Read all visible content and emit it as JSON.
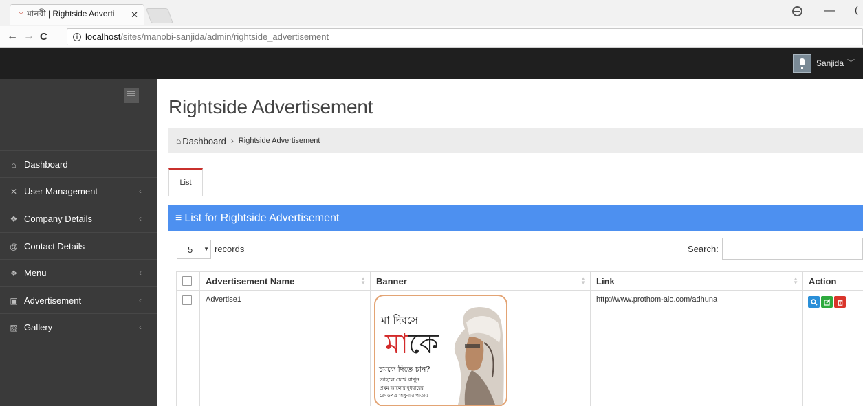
{
  "browser": {
    "tab_title": "মানবী | Rightside Adverti",
    "url_host": "localhost",
    "url_path": "/sites/manobi-sanjida/admin/rightside_advertisement"
  },
  "topbar": {
    "username": "Sanjida"
  },
  "sidebar": {
    "items": [
      {
        "label": "Dashboard",
        "icon": "home-icon"
      },
      {
        "label": "User Management",
        "icon": "arrows-icon"
      },
      {
        "label": "Company Details",
        "icon": "dropbox-icon"
      },
      {
        "label": "Contact Details",
        "icon": "at-icon"
      },
      {
        "label": "Menu",
        "icon": "dropbox-icon"
      },
      {
        "label": "Advertisement",
        "icon": "play-square-icon"
      },
      {
        "label": "Gallery",
        "icon": "image-icon"
      }
    ]
  },
  "page": {
    "title": "Rightside Advertisement",
    "breadcrumb": {
      "home": "Dashboard",
      "current": "Rightside Advertisement"
    },
    "tab": "List",
    "panel_title": "List for Rightside Advertisement"
  },
  "controls": {
    "page_length": "5",
    "records_label": "records",
    "search_label": "Search:"
  },
  "table": {
    "headers": [
      "Advertisement Name",
      "Banner",
      "Link",
      "Action"
    ],
    "rows": [
      {
        "name": "Advertise1",
        "link": "http://www.prothom-alo.com/adhuna",
        "banner": {
          "line1": "মা দিবসে",
          "big_red": "মা",
          "big_black": "কে",
          "line3": "চমকে দিতে চান?",
          "line4": "তাহলে চোখ রাখুন",
          "line5": "প্রথম আলোর বুধবারের",
          "line6": "ক্রোড়পত্র 'অধুনা'র পাতায়"
        }
      }
    ]
  },
  "colors": {
    "panel_header": "#4d90f0",
    "active_tab_border": "#c9302c",
    "sidebar_bg": "#3a3a3a",
    "topbar_bg": "#1f1f1f"
  }
}
